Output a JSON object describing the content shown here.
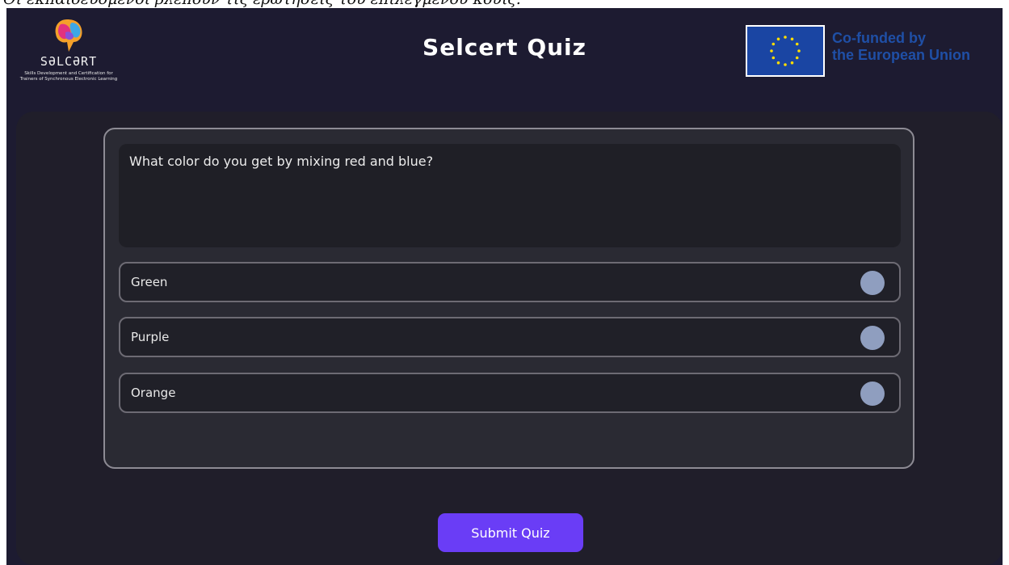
{
  "caption": "Οι εκπαιδευόμενοι βλέπουν τις ερωτήσεις του επιλεγμένου κουίζ.",
  "header": {
    "logo_word": "SƏLCƏRT",
    "logo_tagline": "Skills Development and Certification for Trainers of Synchronous Electronic Learning",
    "title": "Selcert Quiz",
    "eu_line1": "Co-funded by",
    "eu_line2": "the European Union"
  },
  "quiz": {
    "question": "What color do you get by mixing red and blue?",
    "options": [
      {
        "label": "Green"
      },
      {
        "label": "Purple"
      },
      {
        "label": "Orange"
      }
    ],
    "submit_label": "Submit Quiz"
  },
  "colors": {
    "background": "#1d1b31",
    "accent": "#6a3df6",
    "radio": "#8f9ebf",
    "eu_blue": "#1f4fa6"
  },
  "icons": {
    "logo": "brain-logo-icon",
    "eu_flag": "eu-flag-icon",
    "radio": "radio-circle-icon"
  }
}
